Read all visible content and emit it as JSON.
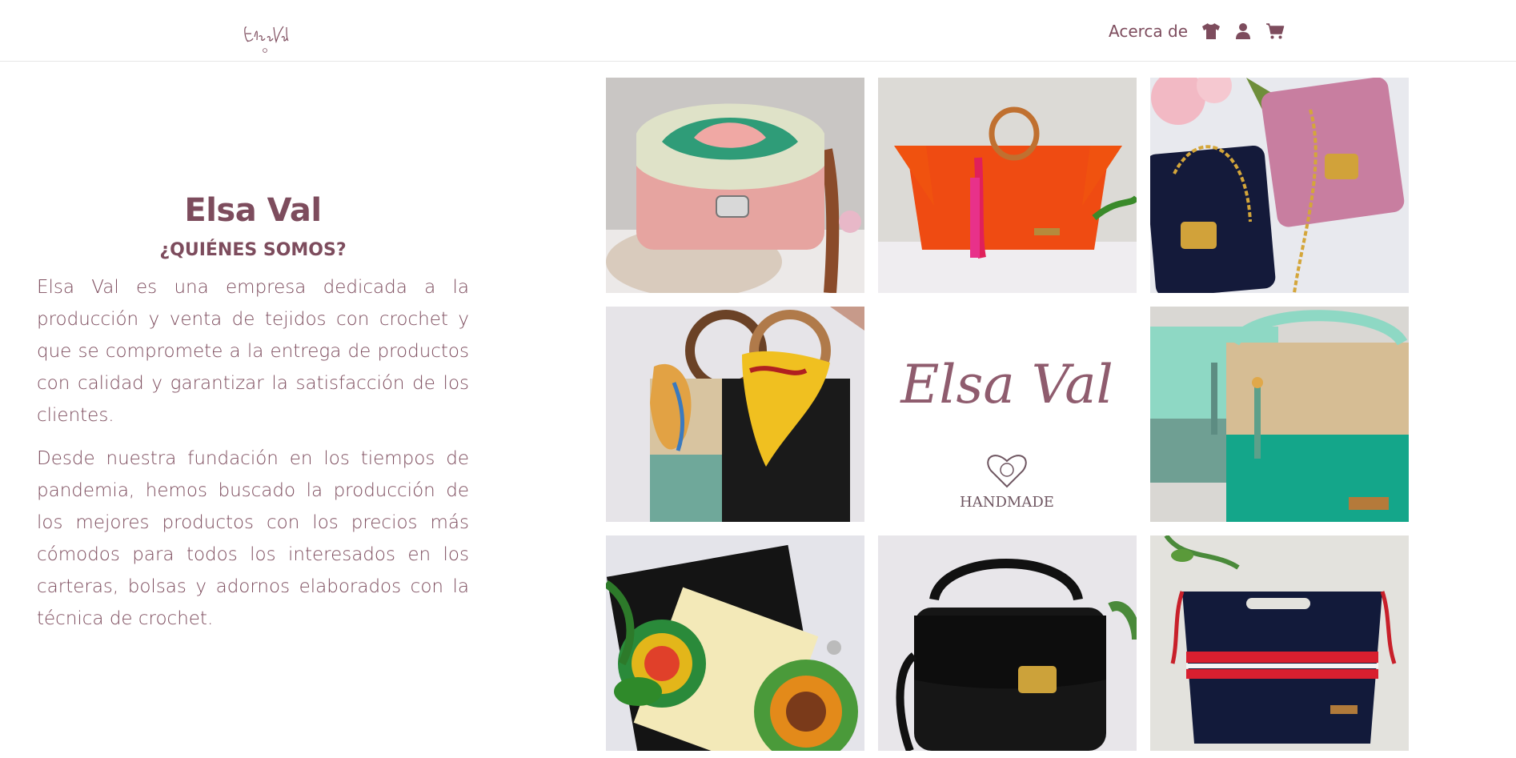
{
  "header": {
    "logo_text": "Elsa Val",
    "nav": {
      "about_label": "Acerca de",
      "icons": [
        "shirt-icon",
        "user-icon",
        "cart-icon"
      ]
    }
  },
  "about": {
    "title": "Elsa Val",
    "subtitle": "¿QUIÉNES SOMOS?",
    "paragraphs": [
      "Elsa Val es una empresa dedicada a la producción y venta de tejidos con crochet y que se compromete a la entrega de productos con calidad y garantizar la satisfacción de los clientes.",
      "Desde nuestra fundación en los tiempos de pandemia, hemos buscado la producción de los mejores productos con los precios más cómodos para todos los interesados en los carteras, bolsas y adornos elaborados con la técnica de crochet."
    ]
  },
  "gallery": {
    "center_logo_text": "Elsa Val",
    "center_badge": "HANDMADE",
    "items": [
      "pink-crochet-bag-photo",
      "orange-crochet-bag-photo",
      "navy-and-pink-bags-photo",
      "scarf-handle-bags-photo",
      "brand-logo-tile",
      "mint-beige-green-bags-photo",
      "granny-square-bags-photo",
      "black-crochet-bag-photo",
      "navy-striped-bag-photo"
    ]
  },
  "colors": {
    "brand": "#7d4c5d",
    "divider": "#e6e6e6"
  }
}
